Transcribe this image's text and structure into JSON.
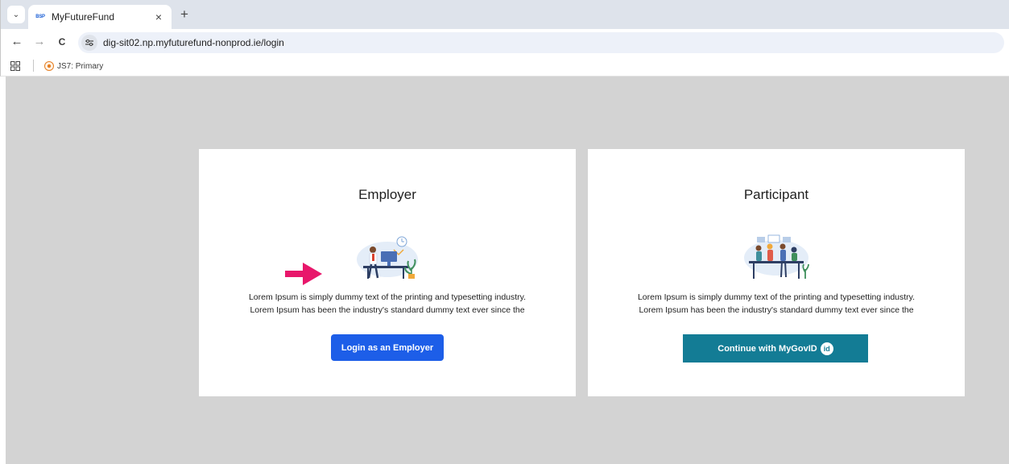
{
  "browser": {
    "tab": {
      "favicon_text": "BSP",
      "title": "MyFutureFund",
      "close_glyph": "×"
    },
    "new_tab_glyph": "+",
    "tab_list_glyph": "⌄",
    "nav": {
      "back_glyph": "←",
      "forward_glyph": "→",
      "reload_glyph": "C"
    },
    "url": "dig-sit02.np.myfuturefund-nonprod.ie/login",
    "bookmarks": [
      {
        "label": "JS7: Primary"
      }
    ]
  },
  "page": {
    "employer_card": {
      "title": "Employer",
      "description_line1": "Lorem Ipsum is simply dummy text of the printing and typesetting industry.",
      "description_line2": "Lorem Ipsum has been the industry's standard dummy text ever since the",
      "button_label": "Login as an Employer"
    },
    "participant_card": {
      "title": "Participant",
      "description_line1": "Lorem Ipsum is simply dummy text of the printing and typesetting industry.",
      "description_line2": "Lorem Ipsum has been the industry's standard dummy text ever since the",
      "button_label": "Continue with MyGovID",
      "button_badge": "id"
    }
  },
  "colors": {
    "page_background": "#d3d3d3",
    "primary_button": "#1d5ee8",
    "mygov_button": "#137c95",
    "annotation_arrow": "#e8176b"
  },
  "icons": [
    "chevron-down-icon",
    "close-icon",
    "plus-icon",
    "back-arrow-icon",
    "forward-arrow-icon",
    "reload-icon",
    "site-info-icon",
    "apps-grid-icon",
    "bookmark-favicon-icon",
    "pointer-arrow-icon"
  ]
}
